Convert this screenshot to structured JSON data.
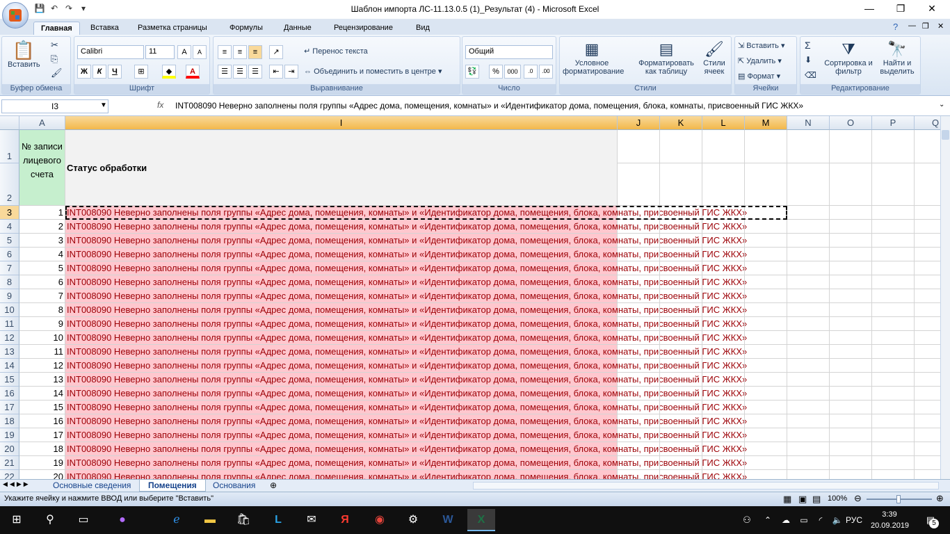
{
  "window": {
    "title": "Шаблон импорта ЛС-11.13.0.5 (1)_Результат (4) - Microsoft Excel"
  },
  "ribbon_tabs": [
    "Главная",
    "Вставка",
    "Разметка страницы",
    "Формулы",
    "Данные",
    "Рецензирование",
    "Вид"
  ],
  "ribbon": {
    "clipboard": {
      "title": "Буфер обмена",
      "paste": "Вставить"
    },
    "font": {
      "title": "Шрифт",
      "name": "Calibri",
      "size": "11",
      "bold": "Ж",
      "italic": "К",
      "underline": "Ч"
    },
    "alignment": {
      "title": "Выравнивание",
      "wrap": "Перенос текста",
      "merge": "Объединить и поместить в центре"
    },
    "number": {
      "title": "Число",
      "format": "Общий",
      "percent": "%",
      "thousands": "000"
    },
    "styles": {
      "title": "Стили",
      "conditional": "Условное форматирование",
      "as_table": "Форматировать как таблицу",
      "cell_styles": "Стили ячеек"
    },
    "cells": {
      "title": "Ячейки",
      "insert": "Вставить",
      "delete": "Удалить",
      "format": "Формат"
    },
    "editing": {
      "title": "Редактирование",
      "sort": "Сортировка и фильтр",
      "find": "Найти и выделить"
    }
  },
  "formula_bar": {
    "name_box": "I3",
    "fx": "fx",
    "content": "INT008090 Неверно заполнены поля группы «Адрес дома, помещения, комнаты» и «Идентификатор дома, помещения, блока, комнаты, присвоенный ГИС ЖКХ»"
  },
  "columns": [
    "A",
    "I",
    "J",
    "K",
    "L",
    "M",
    "N",
    "O",
    "P",
    "Q"
  ],
  "header_row": {
    "col_a": "№ записи лицевого счета",
    "col_i": "Статус обработки"
  },
  "row_numbers": [
    "1",
    "2",
    "3",
    "4",
    "5",
    "6",
    "7",
    "8",
    "9",
    "10",
    "11",
    "12",
    "13",
    "14",
    "15",
    "16",
    "17",
    "18",
    "19",
    "20",
    "21",
    "22"
  ],
  "data_rows": [
    {
      "n": "1"
    },
    {
      "n": "2"
    },
    {
      "n": "3"
    },
    {
      "n": "4"
    },
    {
      "n": "5"
    },
    {
      "n": "6"
    },
    {
      "n": "7"
    },
    {
      "n": "8"
    },
    {
      "n": "9"
    },
    {
      "n": "10"
    },
    {
      "n": "11"
    },
    {
      "n": "12"
    },
    {
      "n": "13"
    },
    {
      "n": "14"
    },
    {
      "n": "15"
    },
    {
      "n": "16"
    },
    {
      "n": "17"
    },
    {
      "n": "18"
    },
    {
      "n": "19"
    },
    {
      "n": "20"
    }
  ],
  "status_text": "INT008090 Неверно заполнены поля группы «Адрес дома, помещения, комнаты» и «Идентификатор дома, помещения, блока, комнаты, присвоенный ГИС ЖКХ»",
  "sheet_tabs": [
    "Основные сведения",
    "Помещения",
    "Основания"
  ],
  "active_sheet": "Помещения",
  "status_bar": {
    "message": "Укажите ячейку и нажмите ВВОД или выберите \"Вставить\"",
    "zoom": "100%"
  },
  "taskbar": {
    "lang": "РУС",
    "time": "3:39",
    "date": "20.09.2019",
    "notif_count": "5"
  },
  "colors": {
    "error_fill": "#ffc7ce",
    "error_text": "#9c0006",
    "header_fill": "#c6efce",
    "selected_header": "#f2b84b"
  }
}
